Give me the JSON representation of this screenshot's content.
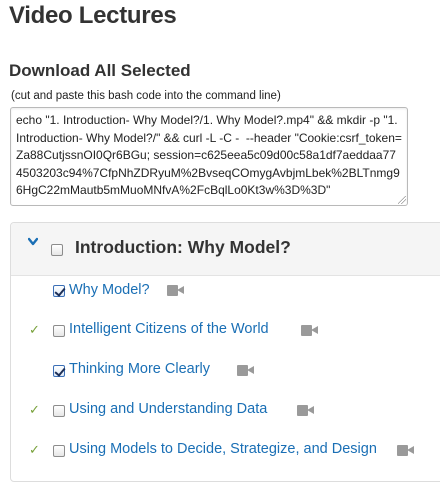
{
  "page": {
    "title": "Video Lectures"
  },
  "download": {
    "heading": "Download All Selected",
    "hint": "(cut and paste this bash code into the command line)",
    "bash_code": "echo \"1. Introduction- Why Model?/1. Why Model?.mp4\" && mkdir -p \"1. Introduction- Why Model?/\" && curl -L -C -  --header \"Cookie:csrf_token=Za88CutjssnOI0Qr6BGu; session=c625eea5c09d00c58a1df7aeddaa774503203c94%7CfpNhZDRyuM%2BvseqCOmygAvbjmLbek%2BLTnmg96HgC22mMautb5mMuoMNfvA%2FcBqlLo0Kt3w%3D%3D\""
  },
  "section": {
    "title": "Introduction: Why Model?",
    "checked": false,
    "chevron_icon": "chevron-down-icon",
    "accent_color": "#1a6fb5",
    "done_color": "#78a13a",
    "items": [
      {
        "label": "Why Model?",
        "checked": true,
        "watched": false,
        "icon": "video-camera-icon"
      },
      {
        "label": "Intelligent Citizens of the World",
        "checked": false,
        "watched": true,
        "icon": "video-camera-icon"
      },
      {
        "label": "Thinking More Clearly",
        "checked": true,
        "watched": false,
        "icon": "video-camera-icon"
      },
      {
        "label": "Using and Understanding Data",
        "checked": false,
        "watched": true,
        "icon": "video-camera-icon"
      },
      {
        "label": "Using Models to Decide, Strategize, and Design",
        "checked": false,
        "watched": true,
        "icon": "video-camera-icon"
      }
    ],
    "watched_glyph": "✓"
  }
}
